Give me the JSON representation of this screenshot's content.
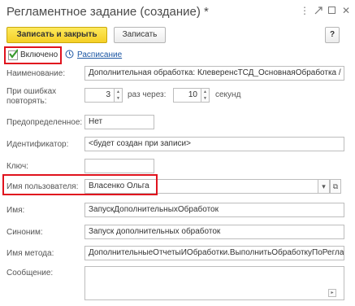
{
  "window": {
    "title": "Регламентное задание (создание) *",
    "menu_icon": "more-vertical-icon",
    "link_icon": "link-icon",
    "minimize_icon": "maximize-icon",
    "close_icon": "close-icon"
  },
  "toolbar": {
    "save_close_label": "Записать и закрыть",
    "save_label": "Записать",
    "help_label": "?"
  },
  "enabled": {
    "label": "Включено",
    "checked": true,
    "schedule_icon": "clock-icon",
    "schedule_link": "Расписание"
  },
  "form": {
    "name_label": "Наименование:",
    "name_value": "Дополнительная обработка: КлеверенсТСД_ОсновнаяОбработка / НаКлавиатуре",
    "retry_label_line1": "При ошибках",
    "retry_label_line2": "повторять:",
    "retry_count": "3",
    "times_through_label": "раз  через:",
    "retry_interval": "10",
    "seconds_label": "секунд",
    "predefined_label": "Предопределенное:",
    "predefined_value": "Нет",
    "identifier_label": "Идентификатор:",
    "identifier_value": "<будет создан при записи>",
    "key_label": "Ключ:",
    "key_value": "",
    "user_label": "Имя пользователя:",
    "user_value": "Власенко Ольга",
    "name2_label": "Имя:",
    "name2_value": "ЗапускДополнительныхОбработок",
    "synonym_label": "Синоним:",
    "synonym_value": "Запуск дополнительных обработок",
    "method_label": "Имя метода:",
    "method_value": "ДополнительныеОтчетыИОбработки.ВыполнитьОбработкуПоРегламентномуЗаданию",
    "message_label": "Сообщение:",
    "message_value": ""
  },
  "colors": {
    "highlight": "#e0131e",
    "primary_button": "#f5cf25",
    "link": "#1b56a3",
    "check": "#3a9a2e"
  }
}
